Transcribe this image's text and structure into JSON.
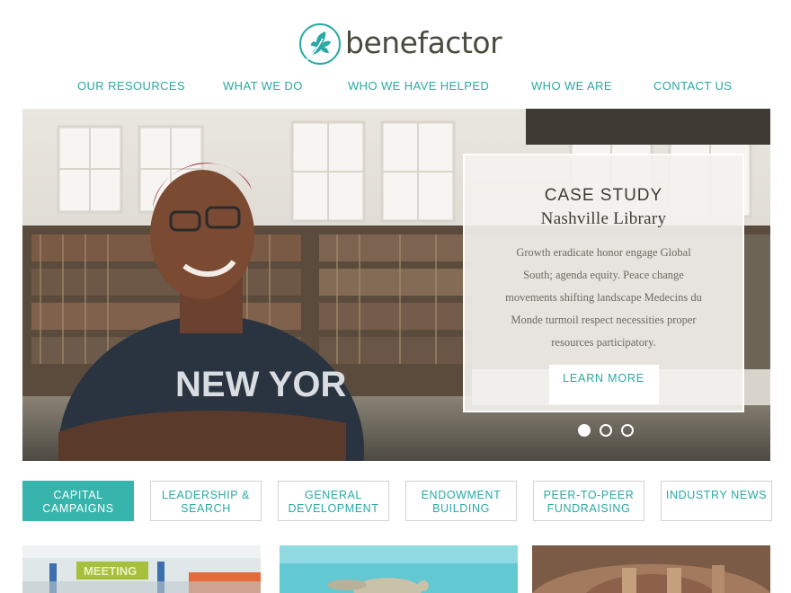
{
  "brand": {
    "name": "benefactor",
    "accent": "#2aa9a5"
  },
  "nav": {
    "items": [
      {
        "label": "OUR RESOURCES"
      },
      {
        "label": "WHAT WE DO"
      },
      {
        "label": "WHO WE HAVE HELPED"
      },
      {
        "label": "WHO WE ARE"
      },
      {
        "label": "CONTACT US"
      }
    ]
  },
  "hero": {
    "photo_text": "NEW YOR",
    "card": {
      "eyebrow": "CASE STUDY",
      "title": "Nashville Library",
      "body": "Growth eradicate honor engage Global South; agenda equity. Peace change movements shifting landscape Medecins du Monde turmoil respect necessities proper resources participatory.",
      "button_label": "LEARN MORE"
    },
    "slides": {
      "count": 3,
      "active": 1
    }
  },
  "service_tabs": [
    {
      "label": "CAPITAL CAMPAIGNS",
      "active": true
    },
    {
      "label": "LEADERSHIP & SEARCH",
      "active": false
    },
    {
      "label": "GENERAL DEVELOPMENT",
      "active": false
    },
    {
      "label": "ENDOWMENT BUILDING",
      "active": false
    },
    {
      "label": "PEER-TO-PEER FUNDRAISING",
      "active": false
    },
    {
      "label": "INDUSTRY NEWS",
      "active": false
    }
  ],
  "thumbnails": [
    {
      "sign_text": "MEETING",
      "icon": "meeting-room-photo"
    },
    {
      "icon": "aquarium-turtle-photo"
    },
    {
      "icon": "theater-interior-photo"
    }
  ]
}
